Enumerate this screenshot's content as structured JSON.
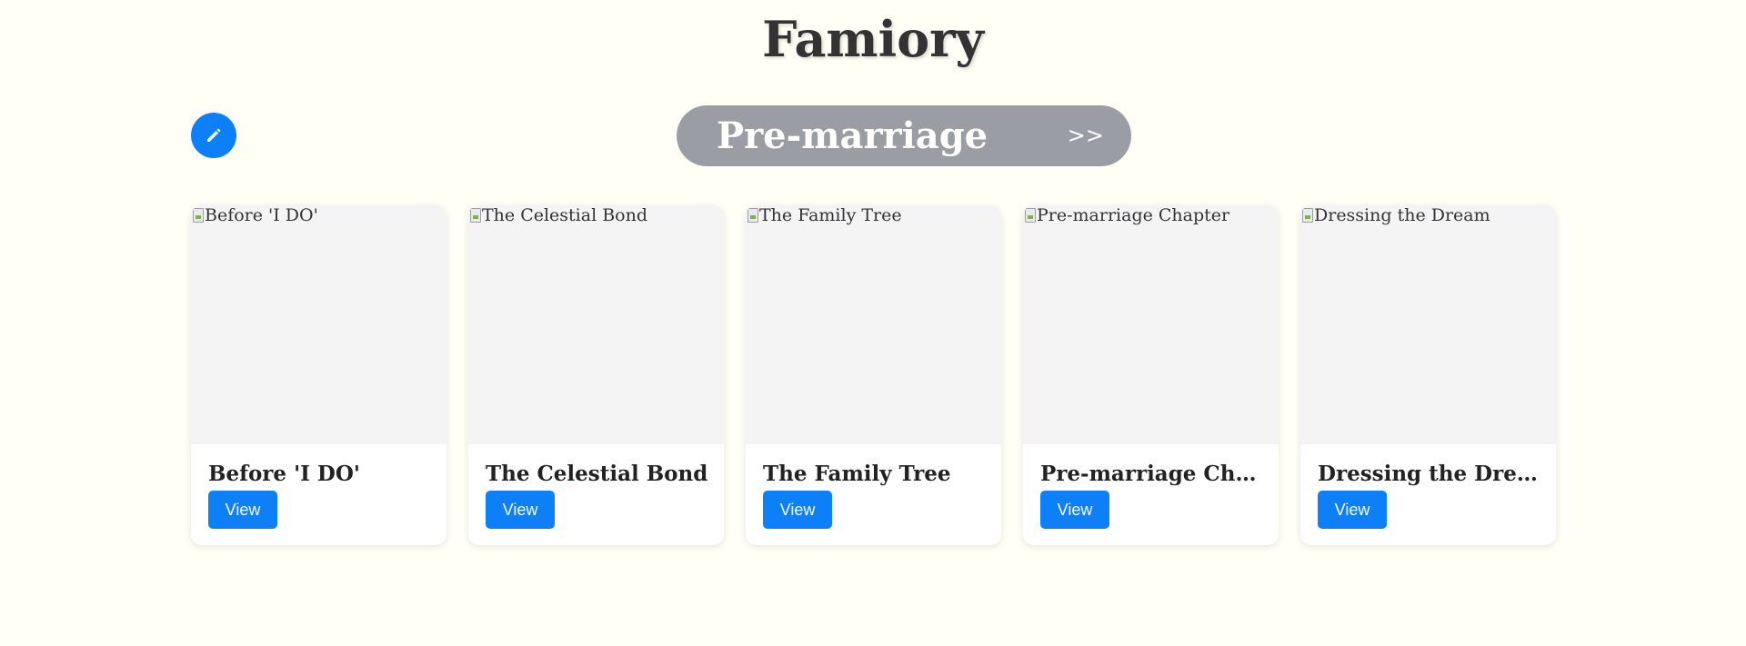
{
  "app": {
    "title": "Famiory"
  },
  "chapter": {
    "name": "Pre-marriage",
    "next_label": ">>"
  },
  "colors": {
    "background": "#fffff6",
    "accent": "#0d7ff7",
    "chapter_pill": "#9a9da3"
  },
  "icons": {
    "edit": "pencil-icon",
    "broken_image": "broken-image-icon"
  },
  "cards": [
    {
      "image_alt": "Before 'I DO'",
      "title": "Before 'I DO'",
      "button_label": "View"
    },
    {
      "image_alt": "The Celestial Bond",
      "title": "The Celestial Bond",
      "button_label": "View"
    },
    {
      "image_alt": "The Family Tree",
      "title": "The Family Tree",
      "button_label": "View"
    },
    {
      "image_alt": "Pre-marriage Chapter",
      "title": "Pre-marriage Chapter",
      "button_label": "View"
    },
    {
      "image_alt": "Dressing the Dream",
      "title": "Dressing the Dream",
      "button_label": "View"
    }
  ]
}
